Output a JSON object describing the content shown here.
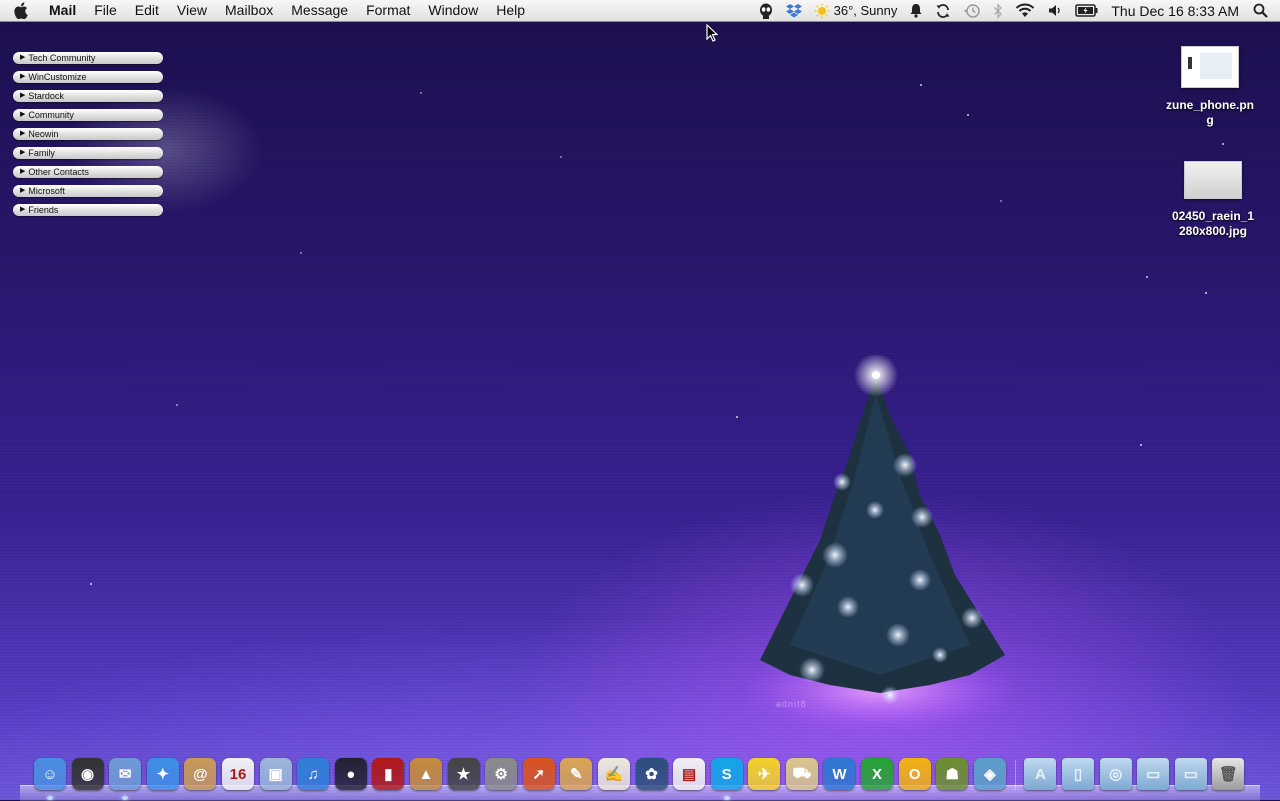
{
  "menubar": {
    "app_name": "Mail",
    "menus": [
      "File",
      "Edit",
      "View",
      "Mailbox",
      "Message",
      "Format",
      "Window",
      "Help"
    ],
    "weather": "36°, Sunny",
    "clock": "Thu Dec 16  8:33 AM",
    "tray_icons": [
      "alien-icon",
      "dropbox-icon",
      "sun-icon",
      "bell-icon",
      "sync-icon",
      "time-machine-icon",
      "bluetooth-icon",
      "wifi-icon",
      "volume-icon",
      "battery-icon",
      "spotlight-icon"
    ]
  },
  "contact_groups": [
    "Tech Community",
    "WinCustomize",
    "Stardock",
    "Community",
    "Neowin",
    "Family",
    "Other Contacts",
    "Microsoft",
    "Friends"
  ],
  "desktop_files": [
    {
      "name": "zune_phone.png",
      "label_line1": "zune_phone.pn",
      "label_line2": "g"
    },
    {
      "name": "02450_raein_1280x800.jpg",
      "label_line1": "02450_raein_1",
      "label_line2": "280x800.jpg"
    }
  ],
  "wallpaper": {
    "watermark": "adnit8"
  },
  "dock": {
    "apps": [
      {
        "name": "Finder",
        "icon": "finder-icon",
        "color": "#4a8fe0",
        "glyph": "☺",
        "running": true
      },
      {
        "name": "Dashboard",
        "icon": "dashboard-icon",
        "color": "#333333",
        "glyph": "◉",
        "running": false
      },
      {
        "name": "Mail",
        "icon": "mail-icon",
        "color": "#6f9ad6",
        "glyph": "✉",
        "running": true
      },
      {
        "name": "Safari",
        "icon": "safari-icon",
        "color": "#3d8fe6",
        "glyph": "✦",
        "running": false
      },
      {
        "name": "Address Book",
        "icon": "address-book-icon",
        "color": "#c99a55",
        "glyph": "@",
        "running": false
      },
      {
        "name": "iCal",
        "icon": "calendar-icon",
        "color": "#f2f2f2",
        "glyph": "16",
        "running": false
      },
      {
        "name": "Preview",
        "icon": "preview-icon",
        "color": "#9bb7d9",
        "glyph": "▣",
        "running": false
      },
      {
        "name": "iTunes",
        "icon": "itunes-icon",
        "color": "#2e7fd8",
        "glyph": "♫",
        "running": false
      },
      {
        "name": "Photo Booth",
        "icon": "photo-booth-icon",
        "color": "#222233",
        "glyph": "●",
        "running": false
      },
      {
        "name": "Photo Booth Strip",
        "icon": "film-strip-icon",
        "color": "#b01818",
        "glyph": "▮",
        "running": false
      },
      {
        "name": "iPhoto",
        "icon": "iphoto-icon",
        "color": "#c58b3c",
        "glyph": "▲",
        "running": false
      },
      {
        "name": "iMovie",
        "icon": "imovie-icon",
        "color": "#444444",
        "glyph": "★",
        "running": false
      },
      {
        "name": "System Preferences",
        "icon": "system-preferences-icon",
        "color": "#8a8a8a",
        "glyph": "⚙",
        "running": false
      },
      {
        "name": "Rocket",
        "icon": "rocket-icon",
        "color": "#d9541e",
        "glyph": "➚",
        "running": false
      },
      {
        "name": "Sketch",
        "icon": "sketch-icon",
        "color": "#d9a552",
        "glyph": "✎",
        "running": false
      },
      {
        "name": "TextEdit",
        "icon": "textedit-icon",
        "color": "#ece8dc",
        "glyph": "✍",
        "running": false
      },
      {
        "name": "Paintbrush",
        "icon": "paint-icon",
        "color": "#2b4f7a",
        "glyph": "✿",
        "running": false
      },
      {
        "name": "News",
        "icon": "news-icon",
        "color": "#f0f0f0",
        "glyph": "▤",
        "running": false
      },
      {
        "name": "Skype",
        "icon": "skype-icon",
        "color": "#12a5e8",
        "glyph": "S",
        "running": true
      },
      {
        "name": "Twitter Bird",
        "icon": "bird-icon",
        "color": "#f3d12a",
        "glyph": "✈",
        "running": false
      },
      {
        "name": "Delivery",
        "icon": "truck-icon",
        "color": "#d9c68c",
        "glyph": "⛟",
        "running": false
      },
      {
        "name": "Word",
        "icon": "word-icon",
        "color": "#2d77d1",
        "glyph": "W",
        "running": false
      },
      {
        "name": "Excel",
        "icon": "excel-icon",
        "color": "#26a336",
        "glyph": "X",
        "running": false
      },
      {
        "name": "Outlook",
        "icon": "outlook-icon",
        "color": "#f2b213",
        "glyph": "O",
        "running": false
      },
      {
        "name": "Adium",
        "icon": "robot-icon",
        "color": "#6c8f2e",
        "glyph": "☗",
        "running": false
      },
      {
        "name": "Network Utility",
        "icon": "network-icon",
        "color": "#5aa0c8",
        "glyph": "◈",
        "running": false
      }
    ],
    "stacks": [
      {
        "name": "Applications",
        "icon": "applications-folder-icon",
        "glyph": "A"
      },
      {
        "name": "Documents",
        "icon": "documents-folder-icon",
        "glyph": "▯"
      },
      {
        "name": "Downloads",
        "icon": "downloads-folder-icon",
        "glyph": "◎"
      },
      {
        "name": "Screen 1",
        "icon": "window-icon",
        "glyph": "▭"
      },
      {
        "name": "Screen 2",
        "icon": "window-icon",
        "glyph": "▭"
      },
      {
        "name": "Trash",
        "icon": "trash-icon",
        "glyph": "🗑"
      }
    ]
  }
}
